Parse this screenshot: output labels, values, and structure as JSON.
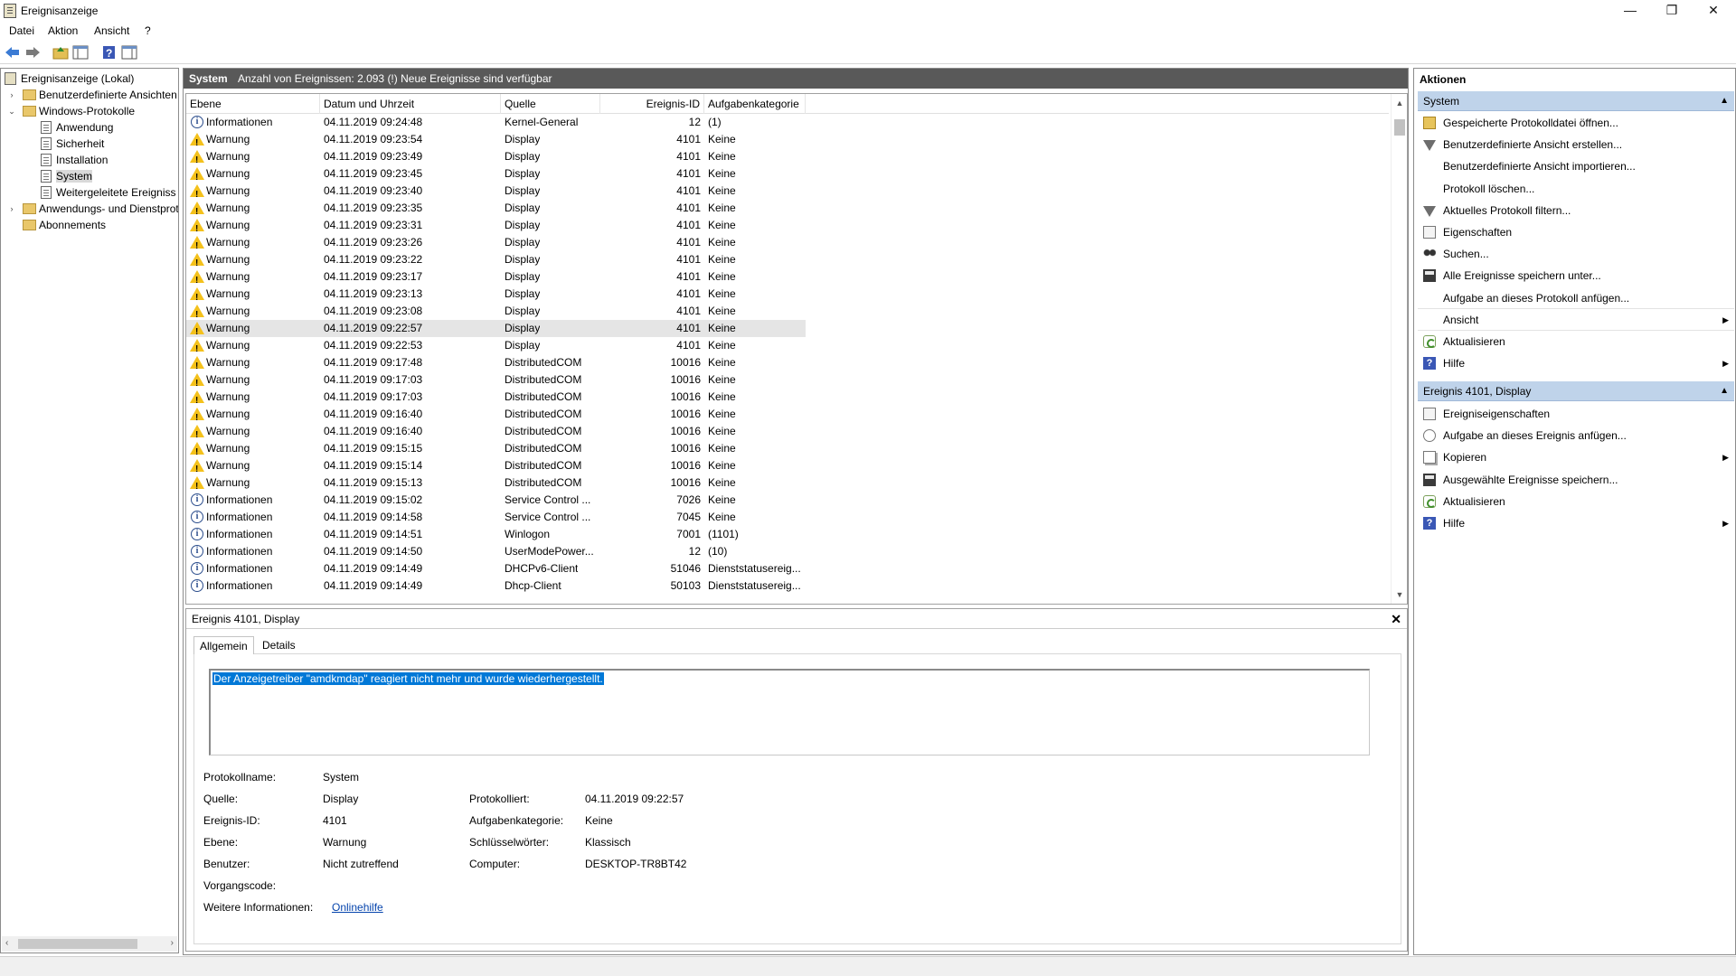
{
  "window": {
    "title": "Ereignisanzeige",
    "minimize": "—",
    "restore": "❐",
    "close": "✕"
  },
  "menu": [
    "Datei",
    "Aktion",
    "Ansicht",
    "?"
  ],
  "toolbar": {
    "icons": [
      "back-icon",
      "forward-icon",
      "up-folder-icon",
      "show-hide-tree-icon",
      "help-icon",
      "show-hide-action-pane-icon"
    ]
  },
  "nav": {
    "root": "Ereignisanzeige (Lokal)",
    "custom_views": "Benutzerdefinierte Ansichten",
    "windows_logs": "Windows-Protokolle",
    "logs": [
      "Anwendung",
      "Sicherheit",
      "Installation",
      "System",
      "Weitergeleitete Ereignisse"
    ],
    "app_service_logs": "Anwendungs- und Dienstprotokolle",
    "subscriptions": "Abonnements",
    "selected": "System"
  },
  "log_header": {
    "name": "System",
    "info": "Anzahl von Ereignissen: 2.093 (!) Neue Ereignisse sind verfügbar"
  },
  "columns": [
    "Ebene",
    "Datum und Uhrzeit",
    "Quelle",
    "Ereignis-ID",
    "Aufgabenkategorie"
  ],
  "events": [
    {
      "level": "Informationen",
      "icon": "info",
      "date": "04.11.2019 09:24:48",
      "source": "Kernel-General",
      "id": "12",
      "category": "(1)"
    },
    {
      "level": "Warnung",
      "icon": "warning",
      "date": "04.11.2019 09:23:54",
      "source": "Display",
      "id": "4101",
      "category": "Keine"
    },
    {
      "level": "Warnung",
      "icon": "warning",
      "date": "04.11.2019 09:23:49",
      "source": "Display",
      "id": "4101",
      "category": "Keine"
    },
    {
      "level": "Warnung",
      "icon": "warning",
      "date": "04.11.2019 09:23:45",
      "source": "Display",
      "id": "4101",
      "category": "Keine"
    },
    {
      "level": "Warnung",
      "icon": "warning",
      "date": "04.11.2019 09:23:40",
      "source": "Display",
      "id": "4101",
      "category": "Keine"
    },
    {
      "level": "Warnung",
      "icon": "warning",
      "date": "04.11.2019 09:23:35",
      "source": "Display",
      "id": "4101",
      "category": "Keine"
    },
    {
      "level": "Warnung",
      "icon": "warning",
      "date": "04.11.2019 09:23:31",
      "source": "Display",
      "id": "4101",
      "category": "Keine"
    },
    {
      "level": "Warnung",
      "icon": "warning",
      "date": "04.11.2019 09:23:26",
      "source": "Display",
      "id": "4101",
      "category": "Keine"
    },
    {
      "level": "Warnung",
      "icon": "warning",
      "date": "04.11.2019 09:23:22",
      "source": "Display",
      "id": "4101",
      "category": "Keine"
    },
    {
      "level": "Warnung",
      "icon": "warning",
      "date": "04.11.2019 09:23:17",
      "source": "Display",
      "id": "4101",
      "category": "Keine"
    },
    {
      "level": "Warnung",
      "icon": "warning",
      "date": "04.11.2019 09:23:13",
      "source": "Display",
      "id": "4101",
      "category": "Keine"
    },
    {
      "level": "Warnung",
      "icon": "warning",
      "date": "04.11.2019 09:23:08",
      "source": "Display",
      "id": "4101",
      "category": "Keine"
    },
    {
      "level": "Warnung",
      "icon": "warning",
      "date": "04.11.2019 09:22:57",
      "source": "Display",
      "id": "4101",
      "category": "Keine",
      "selected": true
    },
    {
      "level": "Warnung",
      "icon": "warning",
      "date": "04.11.2019 09:22:53",
      "source": "Display",
      "id": "4101",
      "category": "Keine"
    },
    {
      "level": "Warnung",
      "icon": "warning",
      "date": "04.11.2019 09:17:48",
      "source": "DistributedCOM",
      "id": "10016",
      "category": "Keine"
    },
    {
      "level": "Warnung",
      "icon": "warning",
      "date": "04.11.2019 09:17:03",
      "source": "DistributedCOM",
      "id": "10016",
      "category": "Keine"
    },
    {
      "level": "Warnung",
      "icon": "warning",
      "date": "04.11.2019 09:17:03",
      "source": "DistributedCOM",
      "id": "10016",
      "category": "Keine"
    },
    {
      "level": "Warnung",
      "icon": "warning",
      "date": "04.11.2019 09:16:40",
      "source": "DistributedCOM",
      "id": "10016",
      "category": "Keine"
    },
    {
      "level": "Warnung",
      "icon": "warning",
      "date": "04.11.2019 09:16:40",
      "source": "DistributedCOM",
      "id": "10016",
      "category": "Keine"
    },
    {
      "level": "Warnung",
      "icon": "warning",
      "date": "04.11.2019 09:15:15",
      "source": "DistributedCOM",
      "id": "10016",
      "category": "Keine"
    },
    {
      "level": "Warnung",
      "icon": "warning",
      "date": "04.11.2019 09:15:14",
      "source": "DistributedCOM",
      "id": "10016",
      "category": "Keine"
    },
    {
      "level": "Warnung",
      "icon": "warning",
      "date": "04.11.2019 09:15:13",
      "source": "DistributedCOM",
      "id": "10016",
      "category": "Keine"
    },
    {
      "level": "Informationen",
      "icon": "info",
      "date": "04.11.2019 09:15:02",
      "source": "Service Control ...",
      "id": "7026",
      "category": "Keine"
    },
    {
      "level": "Informationen",
      "icon": "info",
      "date": "04.11.2019 09:14:58",
      "source": "Service Control ...",
      "id": "7045",
      "category": "Keine"
    },
    {
      "level": "Informationen",
      "icon": "info",
      "date": "04.11.2019 09:14:51",
      "source": "Winlogon",
      "id": "7001",
      "category": "(1101)"
    },
    {
      "level": "Informationen",
      "icon": "info",
      "date": "04.11.2019 09:14:50",
      "source": "UserModePower...",
      "id": "12",
      "category": "(10)"
    },
    {
      "level": "Informationen",
      "icon": "info",
      "date": "04.11.2019 09:14:49",
      "source": "DHCPv6-Client",
      "id": "51046",
      "category": "Dienststatusereig..."
    },
    {
      "level": "Informationen",
      "icon": "info",
      "date": "04.11.2019 09:14:49",
      "source": "Dhcp-Client",
      "id": "50103",
      "category": "Dienststatusereig..."
    }
  ],
  "detail": {
    "title": "Ereignis 4101, Display",
    "close": "✕",
    "tabs": [
      "Allgemein",
      "Details"
    ],
    "message": "Der Anzeigetreiber \"amdkmdap\" reagiert nicht mehr und wurde wiederhergestellt.",
    "fields": {
      "log_name_label": "Protokollname:",
      "log_name": "System",
      "source_label": "Quelle:",
      "source": "Display",
      "logged_label": "Protokolliert:",
      "logged": "04.11.2019 09:22:57",
      "event_id_label": "Ereignis-ID:",
      "event_id": "4101",
      "task_category_label": "Aufgabenkategorie:",
      "task_category": "Keine",
      "level_label": "Ebene:",
      "level": "Warnung",
      "keywords_label": "Schlüsselwörter:",
      "keywords": "Klassisch",
      "user_label": "Benutzer:",
      "user": "Nicht zutreffend",
      "computer_label": "Computer:",
      "computer": "DESKTOP-TR8BT42",
      "opcode_label": "Vorgangscode:",
      "opcode": "",
      "more_info_label": "Weitere Informationen:",
      "more_info_link": "Onlinehilfe"
    }
  },
  "actions": {
    "title": "Aktionen",
    "section1": {
      "title": "System",
      "items": [
        {
          "label": "Gespeicherte Protokolldatei öffnen...",
          "icon": "open-folder-icon"
        },
        {
          "label": "Benutzerdefinierte Ansicht erstellen...",
          "icon": "filter-icon"
        },
        {
          "label": "Benutzerdefinierte Ansicht importieren...",
          "icon": ""
        },
        {
          "label": "Protokoll löschen...",
          "icon": ""
        },
        {
          "label": "Aktuelles Protokoll filtern...",
          "icon": "filter-icon"
        },
        {
          "label": "Eigenschaften",
          "icon": "properties-icon"
        },
        {
          "label": "Suchen...",
          "icon": "binoculars-icon"
        },
        {
          "label": "Alle Ereignisse speichern unter...",
          "icon": "save-icon"
        },
        {
          "label": "Aufgabe an dieses Protokoll anfügen...",
          "icon": ""
        },
        {
          "label": "Ansicht",
          "icon": "",
          "submenu": true
        },
        {
          "label": "Aktualisieren",
          "icon": "refresh-icon"
        },
        {
          "label": "Hilfe",
          "icon": "help-icon",
          "submenu": true
        }
      ]
    },
    "section2": {
      "title": "Ereignis 4101, Display",
      "items": [
        {
          "label": "Ereigniseigenschaften",
          "icon": "properties-icon"
        },
        {
          "label": "Aufgabe an dieses Ereignis anfügen...",
          "icon": "task-icon"
        },
        {
          "label": "Kopieren",
          "icon": "copy-icon",
          "submenu": true
        },
        {
          "label": "Ausgewählte Ereignisse speichern...",
          "icon": "save-icon"
        },
        {
          "label": "Aktualisieren",
          "icon": "refresh-icon"
        },
        {
          "label": "Hilfe",
          "icon": "help-icon",
          "submenu": true
        }
      ]
    }
  }
}
